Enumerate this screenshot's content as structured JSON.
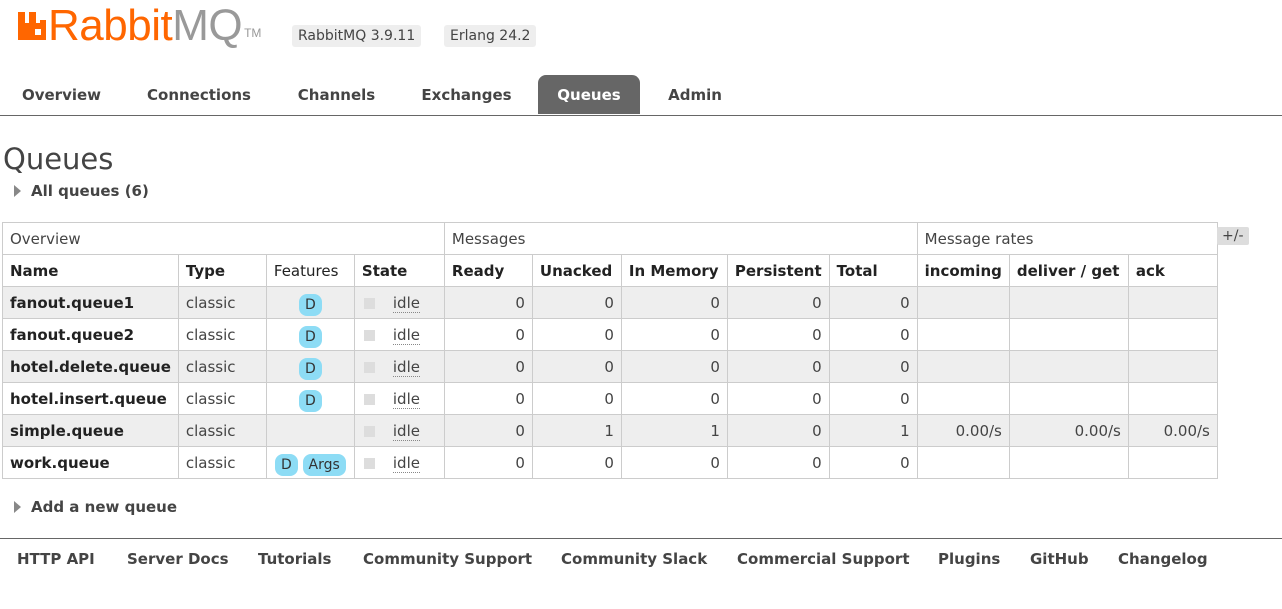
{
  "header": {
    "logo_rabbit": "Rabbit",
    "logo_mq": "MQ",
    "logo_tm": "TM",
    "rabbitmq_version": "RabbitMQ 3.9.11",
    "erlang_version": "Erlang 24.2"
  },
  "tabs": [
    {
      "label": "Overview"
    },
    {
      "label": "Connections"
    },
    {
      "label": "Channels"
    },
    {
      "label": "Exchanges"
    },
    {
      "label": "Queues",
      "active": true
    },
    {
      "label": "Admin"
    }
  ],
  "page": {
    "title": "Queues",
    "all_queues": "All queues (6)",
    "add_queue": "Add a new queue",
    "column_toggle": "+/-"
  },
  "table": {
    "groups": {
      "overview": "Overview",
      "messages": "Messages",
      "rates": "Message rates"
    },
    "columns": {
      "name": "Name",
      "type": "Type",
      "features": "Features",
      "state": "State",
      "ready": "Ready",
      "unacked": "Unacked",
      "in_memory": "In Memory",
      "persistent": "Persistent",
      "total": "Total",
      "incoming": "incoming",
      "deliver_get": "deliver / get",
      "ack": "ack"
    },
    "rows": [
      {
        "name": "fanout.queue1",
        "type": "classic",
        "features": [
          "D"
        ],
        "state": "idle",
        "ready": "0",
        "unacked": "0",
        "in_memory": "0",
        "persistent": "0",
        "total": "0",
        "incoming": "",
        "deliver_get": "",
        "ack": ""
      },
      {
        "name": "fanout.queue2",
        "type": "classic",
        "features": [
          "D"
        ],
        "state": "idle",
        "ready": "0",
        "unacked": "0",
        "in_memory": "0",
        "persistent": "0",
        "total": "0",
        "incoming": "",
        "deliver_get": "",
        "ack": ""
      },
      {
        "name": "hotel.delete.queue",
        "type": "classic",
        "features": [
          "D"
        ],
        "state": "idle",
        "ready": "0",
        "unacked": "0",
        "in_memory": "0",
        "persistent": "0",
        "total": "0",
        "incoming": "",
        "deliver_get": "",
        "ack": ""
      },
      {
        "name": "hotel.insert.queue",
        "type": "classic",
        "features": [
          "D"
        ],
        "state": "idle",
        "ready": "0",
        "unacked": "0",
        "in_memory": "0",
        "persistent": "0",
        "total": "0",
        "incoming": "",
        "deliver_get": "",
        "ack": ""
      },
      {
        "name": "simple.queue",
        "type": "classic",
        "features": [],
        "state": "idle",
        "ready": "0",
        "unacked": "1",
        "in_memory": "1",
        "persistent": "0",
        "total": "1",
        "incoming": "0.00/s",
        "deliver_get": "0.00/s",
        "ack": "0.00/s"
      },
      {
        "name": "work.queue",
        "type": "classic",
        "features": [
          "D",
          "Args"
        ],
        "state": "idle",
        "ready": "0",
        "unacked": "0",
        "in_memory": "0",
        "persistent": "0",
        "total": "0",
        "incoming": "",
        "deliver_get": "",
        "ack": ""
      }
    ]
  },
  "footer": {
    "links": [
      "HTTP API",
      "Server Docs",
      "Tutorials",
      "Community Support",
      "Community Slack",
      "Commercial Support",
      "Plugins",
      "GitHub",
      "Changelog"
    ]
  },
  "colors": {
    "brand": "#ff6600",
    "feature_badge": "#8ddcf5",
    "active_tab": "#666666"
  }
}
